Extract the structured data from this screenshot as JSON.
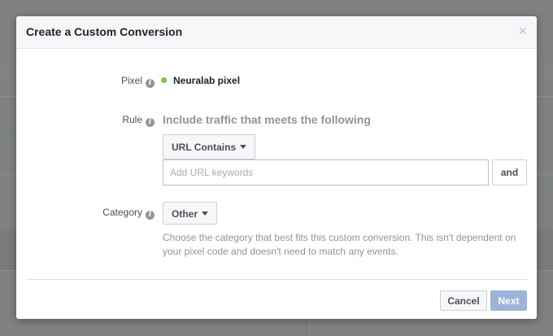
{
  "dialog": {
    "title": "Create a Custom Conversion",
    "close_glyph": "×"
  },
  "pixel": {
    "label": "Pixel",
    "name": "Neuralab pixel",
    "status_color": "#7bc34a"
  },
  "rule": {
    "label": "Rule",
    "heading": "Include traffic that meets the following",
    "condition_selected": "URL Contains",
    "keyword_input_value": "",
    "keyword_input_placeholder": "Add URL keywords",
    "and_label": "and"
  },
  "category": {
    "label": "Category",
    "selected": "Other",
    "help_text": "Choose the category that best fits this custom conversion. This isn't dependent on your pixel code and doesn't need to match any events."
  },
  "footer": {
    "cancel_label": "Cancel",
    "next_label": "Next"
  },
  "colors": {
    "accent_disabled": "#9cb4d8",
    "title_text": "#1d2129",
    "muted_text": "#90949c"
  },
  "icons": {
    "info": "info-icon",
    "close": "close-icon",
    "caret": "chevron-down-icon"
  }
}
